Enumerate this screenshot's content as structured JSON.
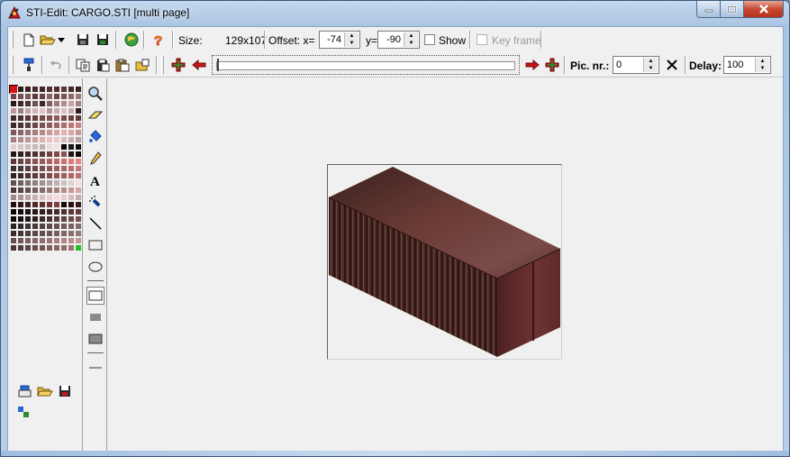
{
  "window": {
    "title": "STI-Edit: CARGO.STI [multi page]"
  },
  "toolbar1": {
    "size_label": "Size:",
    "size_value": "129x107",
    "offset_label": "Offset: x=",
    "offset_x": "-74",
    "y_label": "y=",
    "offset_y": "-90",
    "show_label": "Show",
    "keyframe_label": "Key frame"
  },
  "toolbar2": {
    "pic_nr_label": "Pic. nr.:",
    "pic_nr_value": "0",
    "delay_label": "Delay:",
    "delay_value": "100",
    "frame_progress": 0.0
  },
  "colors": {
    "accent_red": "#c8161c",
    "add_green": "#2f8a2a",
    "crate_top": "#6a3b35",
    "crate_side": "#4b2622",
    "crate_end": "#5e2a2a"
  },
  "palette": [
    "#c8161c",
    "#2a2020",
    "#3a2020",
    "#4a2a2a",
    "#3e2626",
    "#543030",
    "#4e2c2c",
    "#5c3434",
    "#4a2828",
    "#3a2222",
    "#6e4848",
    "#745050",
    "#7e5858",
    "#5a3a3a",
    "#664444",
    "#8a6464",
    "#6a4646",
    "#7a5454",
    "#8e6a6a",
    "#a07a7a",
    "#2a1a1a",
    "#3a2626",
    "#4e3434",
    "#6e5050",
    "#3e2a2a",
    "#806060",
    "#9a7a7a",
    "#b08e8e",
    "#c4a4a4",
    "#a48484",
    "#b89898",
    "#9c7c7c",
    "#c2a2a2",
    "#d4b4b4",
    "#e0c4c4",
    "#b49696",
    "#c8aaaa",
    "#dcc0c0",
    "#caaaaa",
    "#2e2020",
    "#3a2a2a",
    "#4a3030",
    "#5a3636",
    "#684040",
    "#764848",
    "#845252",
    "#925a5a",
    "#7c4c4c",
    "#6c4242",
    "#5c3838",
    "#3c2828",
    "#4c3232",
    "#5c3c3c",
    "#6c4646",
    "#7c5050",
    "#8c5a5a",
    "#9c6464",
    "#ac6e6e",
    "#bc7878",
    "#cc8282",
    "#7a5a5a",
    "#8a6666",
    "#9a7272",
    "#aa7e7e",
    "#ba8a8a",
    "#ca9696",
    "#daa2a2",
    "#eab0b0",
    "#d8a8a8",
    "#c89898",
    "#a08080",
    "#b08c8c",
    "#c09898",
    "#d0a4a4",
    "#e0b0b0",
    "#f0c0c0",
    "#e8c8c8",
    "#d8bcbc",
    "#c8b0b0",
    "#b8a4a4",
    "#e0d0d0",
    "#d8c8c8",
    "#d0c0c0",
    "#c8b8b8",
    "#c0b0b0",
    "#e8dcdc",
    "#f0e4e4",
    "#0a0a0a",
    "#1a1a1a",
    "#101010",
    "#201818",
    "#302020",
    "#402828",
    "#503030",
    "#603838",
    "#704040",
    "#804848",
    "#905050",
    "#1e1414",
    "#0e0a0a",
    "#5a3a3a",
    "#6a4242",
    "#7a4a4a",
    "#8a5252",
    "#9a5a5a",
    "#aa6262",
    "#ba6a6a",
    "#ca7272",
    "#da7a7a",
    "#ea8282",
    "#3a3030",
    "#4a3838",
    "#5a4040",
    "#6a4848",
    "#7a5050",
    "#8a5858",
    "#9a6060",
    "#aa6868",
    "#ba7070",
    "#ca7878",
    "#2e2424",
    "#3e2c2c",
    "#4e3434",
    "#5e3c3c",
    "#6e4444",
    "#7e4c4c",
    "#8e5454",
    "#9e5c5c",
    "#ae6464",
    "#be6c6c",
    "#605050",
    "#706060",
    "#807070",
    "#908080",
    "#a09090",
    "#b0a0a0",
    "#c0b0b0",
    "#d0c0c0",
    "#e0d0d0",
    "#f0e0e0",
    "#483838",
    "#584444",
    "#685050",
    "#785c5c",
    "#886868",
    "#987474",
    "#a88080",
    "#b88c8c",
    "#c89898",
    "#d8a4a4",
    "#9a8a8a",
    "#aa9696",
    "#baa2a2",
    "#cab0b0",
    "#dac0c0",
    "#ead0d0",
    "#f4dcdc",
    "#e4ccd0",
    "#d4bcc0",
    "#c4acb0",
    "#201010",
    "#301818",
    "#402020",
    "#502828",
    "#603030",
    "#703838",
    "#804040",
    "#1a0a0a",
    "#2a1212",
    "#3a1a1a",
    "#0a0606",
    "#140c0c",
    "#1e1212",
    "#281818",
    "#321e1e",
    "#3c2424",
    "#462a2a",
    "#503030",
    "#5a3636",
    "#643c3c",
    "#0c0808",
    "#181010",
    "#241818",
    "#302020",
    "#3c2828",
    "#483030",
    "#543838",
    "#604040",
    "#6c4848",
    "#785050",
    "#2a2222",
    "#342a2a",
    "#3e3232",
    "#483a3a",
    "#524242",
    "#5c4a4a",
    "#665252",
    "#705a5a",
    "#7a6262",
    "#846a6a",
    "#3a2e2e",
    "#443636",
    "#4e3e3e",
    "#584646",
    "#624e4e",
    "#6c5656",
    "#765e5e",
    "#806666",
    "#8a6e6e",
    "#947676",
    "#6a4e4e",
    "#745656",
    "#7e5e5e",
    "#886666",
    "#926e6e",
    "#9c7676",
    "#a67e7e",
    "#b08686",
    "#ba8e8e",
    "#c49696",
    "#4a3434",
    "#543c3c",
    "#5e4444",
    "#684c4c",
    "#725454",
    "#7c5c5c",
    "#866464",
    "#906c6c",
    "#9a7474",
    "#22c022"
  ],
  "pic_nr_options": [],
  "icons": {
    "new": "new-file-icon",
    "open": "open-folder-icon",
    "save": "save-icon",
    "save_as": "save-all-icon",
    "globe": "globe-icon",
    "help": "help-icon"
  }
}
